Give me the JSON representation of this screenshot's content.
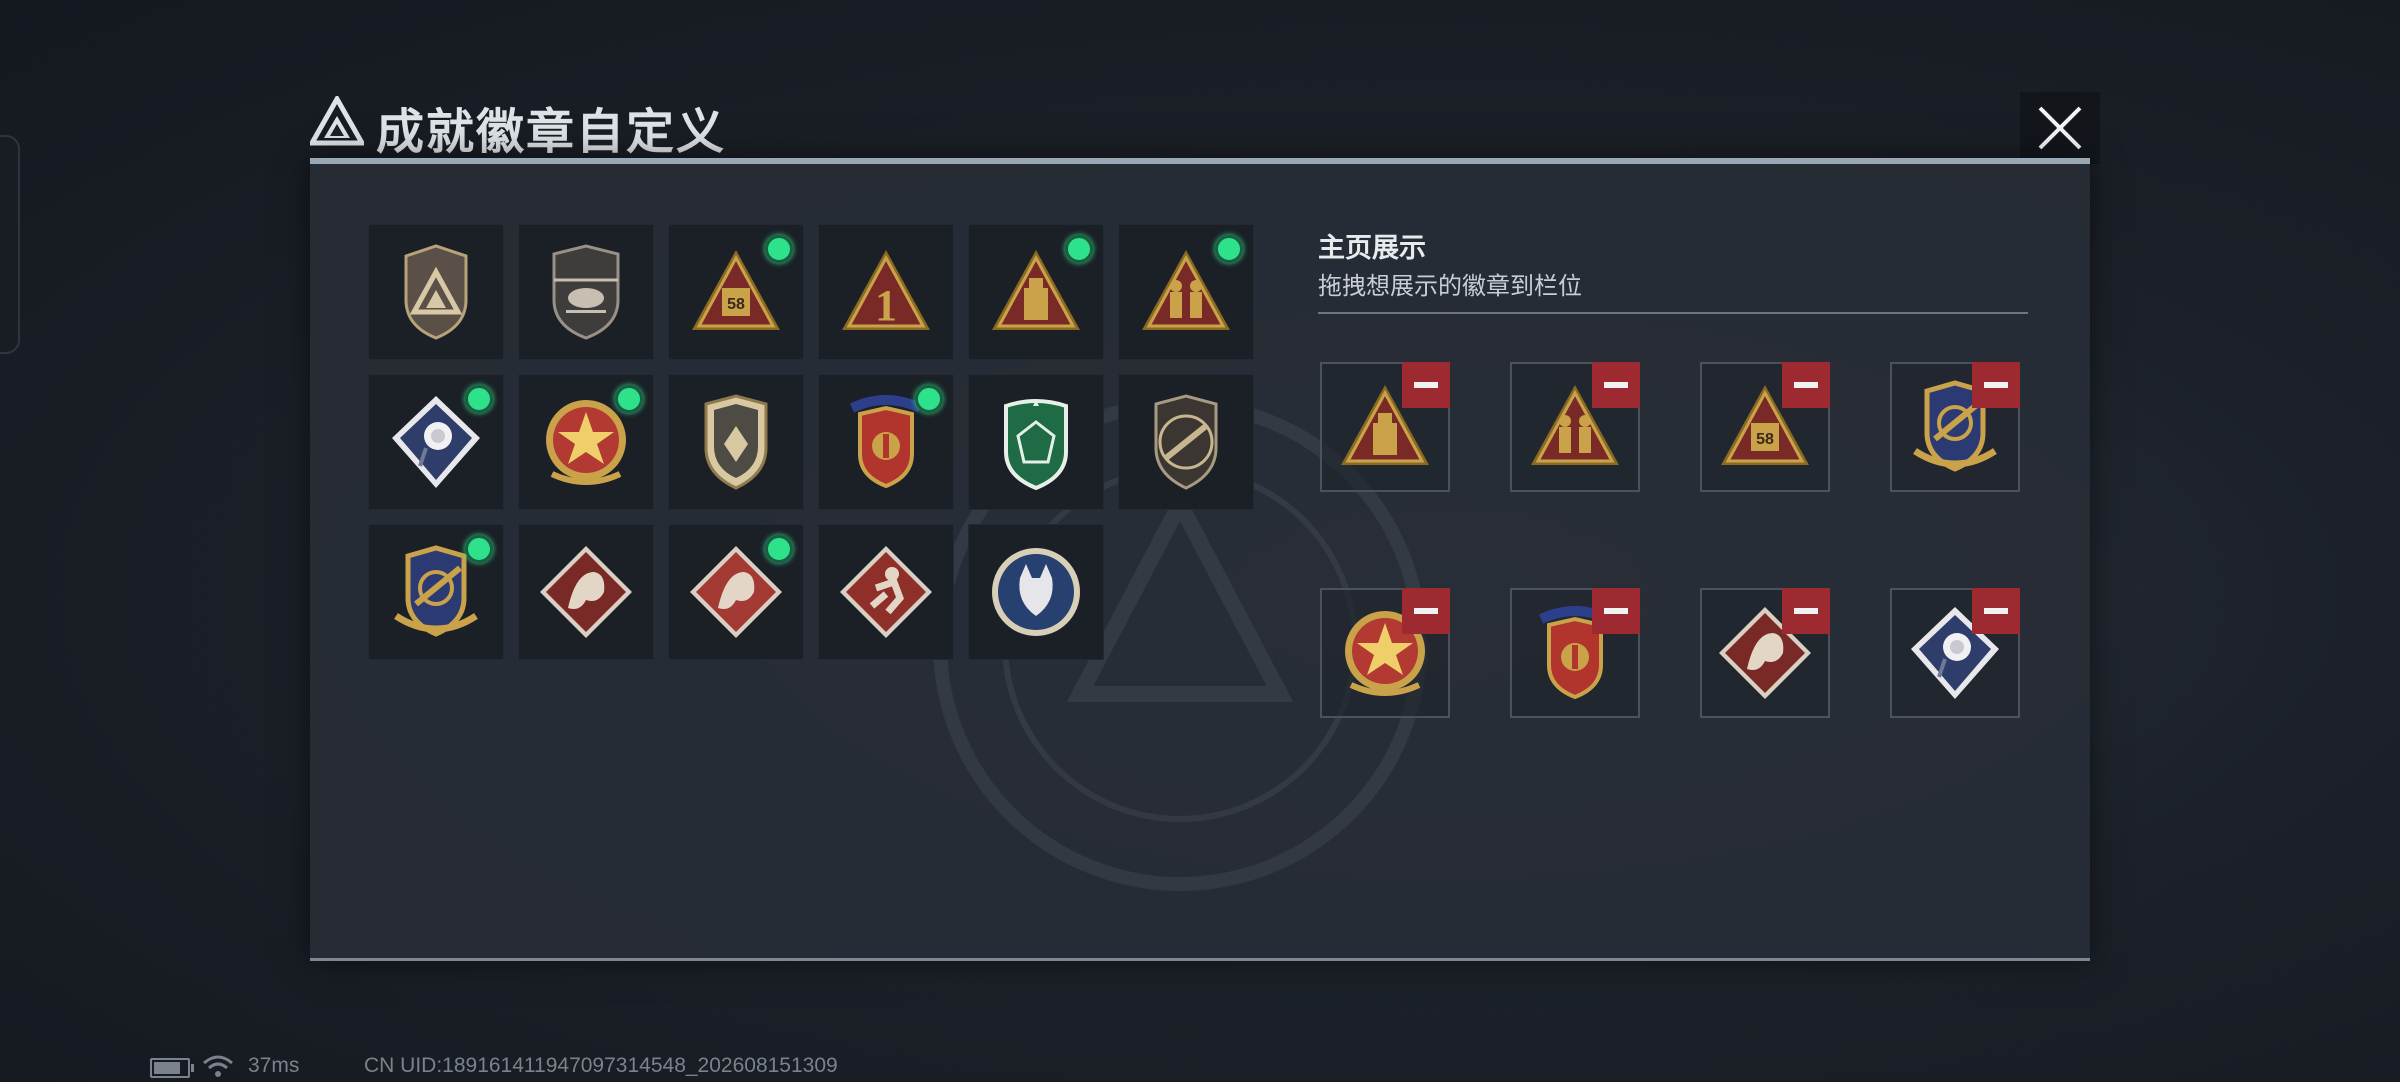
{
  "window": {
    "title": "成就徽章自定义",
    "logo_icon": "triangle-logo-icon",
    "close_icon": "close-icon"
  },
  "badges": [
    {
      "name": "triangle-shield-badge",
      "new": false
    },
    {
      "name": "helicopter-badge",
      "new": false
    },
    {
      "name": "triangle-58-badge",
      "new": true,
      "text": "58"
    },
    {
      "name": "triangle-1-badge",
      "new": false,
      "text": "1"
    },
    {
      "name": "triangle-usb-badge",
      "new": true
    },
    {
      "name": "triangle-soldiers-badge",
      "new": true
    },
    {
      "name": "rose-diamond-badge",
      "new": true
    },
    {
      "name": "star-medal-badge",
      "new": true
    },
    {
      "name": "shield-emblem-badge",
      "new": false
    },
    {
      "name": "laurel-crest-badge",
      "new": true
    },
    {
      "name": "green-gem-badge",
      "new": false
    },
    {
      "name": "rifle-shield-badge",
      "new": false
    },
    {
      "name": "crosshair-shield-badge",
      "new": true
    },
    {
      "name": "dragon-diamond-badge",
      "new": false
    },
    {
      "name": "dragon-diamond-2-badge",
      "new": true
    },
    {
      "name": "runner-diamond-badge",
      "new": false
    },
    {
      "name": "lynx-medallion-badge",
      "new": false
    }
  ],
  "display": {
    "title": "主页展示",
    "subtitle": "拖拽想展示的徽章到栏位",
    "remove_icon": "minus-icon",
    "slots": [
      {
        "badge": "triangle-usb-badge"
      },
      {
        "badge": "triangle-soldiers-badge"
      },
      {
        "badge": "triangle-58-badge",
        "text": "58"
      },
      {
        "badge": "crosshair-shield-badge"
      },
      {
        "badge": "star-medal-badge"
      },
      {
        "badge": "laurel-crest-badge"
      },
      {
        "badge": "dragon-diamond-badge"
      },
      {
        "badge": "rose-diamond-badge"
      }
    ]
  },
  "status": {
    "ping": "37ms",
    "uid": "CN UID:18916141194709731454​8_202608151309"
  },
  "colors": {
    "new_dot": "#2ee28c",
    "remove_button": "#9c2a30",
    "gold": "#c9a24a"
  }
}
